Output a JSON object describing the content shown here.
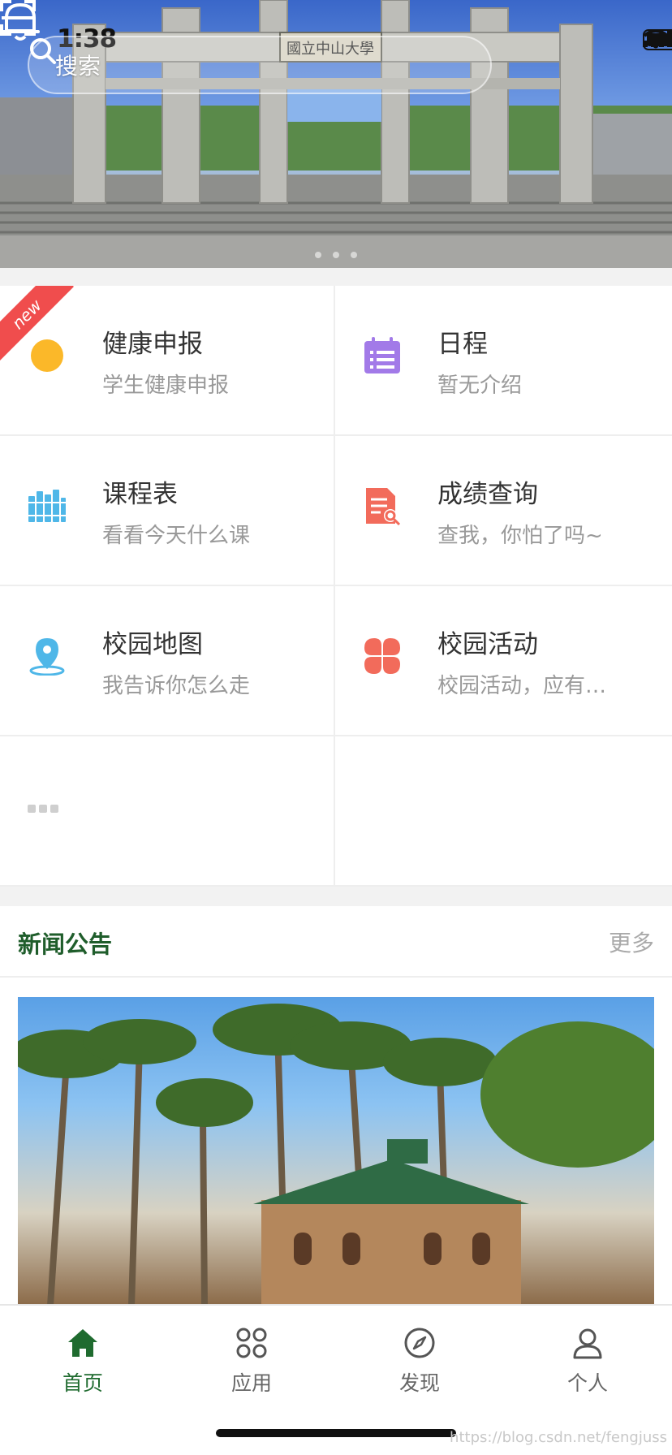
{
  "status_bar": {
    "time": "1:38"
  },
  "header": {
    "search_placeholder": "搜索"
  },
  "banner": {
    "slides": 3,
    "active_slide": 1,
    "sign_text": "國立中山大學"
  },
  "apps": [
    {
      "title": "健康申报",
      "desc": "学生健康申报",
      "icon": "health-icon",
      "badge": "new",
      "color": "#fbb829"
    },
    {
      "title": "日程",
      "desc": "暂无介绍",
      "icon": "calendar-icon",
      "color": "#a27ae8"
    },
    {
      "title": "课程表",
      "desc": "看看今天什么课",
      "icon": "books-icon",
      "color": "#4fb7e8"
    },
    {
      "title": "成绩查询",
      "desc": "查我，你怕了吗~",
      "icon": "grade-search-icon",
      "color": "#f26b5b"
    },
    {
      "title": "校园地图",
      "desc": "我告诉你怎么走",
      "icon": "map-pin-icon",
      "color": "#4fb7e8"
    },
    {
      "title": "校园活动",
      "desc": "校园活动，应有…",
      "icon": "clover-icon",
      "color": "#f26b5b"
    }
  ],
  "news": {
    "title": "新闻公告",
    "more": "更多"
  },
  "tabs": [
    {
      "label": "首页",
      "icon": "home-icon",
      "active": true
    },
    {
      "label": "应用",
      "icon": "apps-icon",
      "active": false
    },
    {
      "label": "发现",
      "icon": "compass-icon",
      "active": false
    },
    {
      "label": "个人",
      "icon": "person-icon",
      "active": false
    }
  ],
  "watermark": "https://blog.csdn.net/fengjuss",
  "colors": {
    "accent": "#1f6b2f",
    "ribbon": "#f04d4d"
  }
}
